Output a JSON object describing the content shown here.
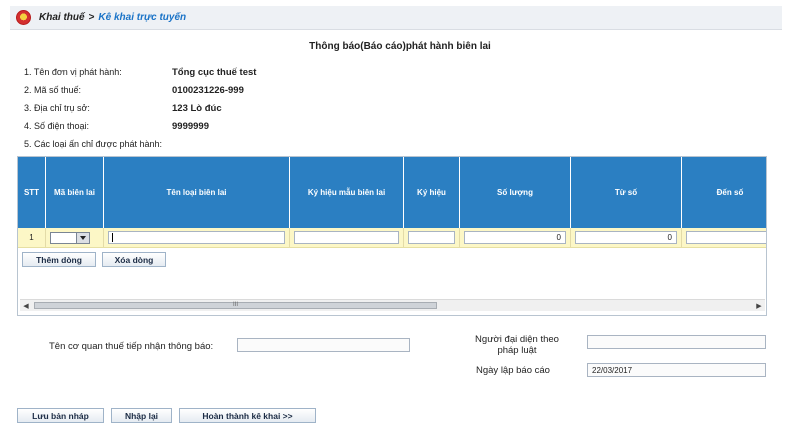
{
  "breadcrumb": {
    "parent": "Khai thuế",
    "separator": ">",
    "current": "Kê khai trực tuyến"
  },
  "form": {
    "title": "Thông báo(Báo cáo)phát hành biên lai",
    "info": [
      {
        "label": "1. Tên đơn vị phát hành:",
        "value": "Tổng cục thuế test"
      },
      {
        "label": "2. Mã số thuế:",
        "value": "0100231226-999"
      },
      {
        "label": "3. Địa chỉ trụ sở:",
        "value": "123 Lò đúc"
      },
      {
        "label": "4. Số điện thoại:",
        "value": "9999999"
      },
      {
        "label": "5. Các loại ấn chỉ được phát hành:",
        "value": ""
      }
    ]
  },
  "table": {
    "columns": [
      "STT",
      "Mã biên lai",
      "Tên loại biên lai",
      "Ký hiệu mẫu biên lai",
      "Ký hiệu",
      "Số lượng",
      "Từ số",
      "Đến số"
    ],
    "row": {
      "stt": "1",
      "ma_bien_lai": "",
      "ten_loai": "",
      "ky_hieu_mau": "",
      "ky_hieu": "",
      "so_luong": "0",
      "tu_so": "0",
      "den_so": ""
    },
    "add_row_label": "Thêm dòng",
    "delete_row_label": "Xóa dòng",
    "scroll_thumb_label": "III"
  },
  "receiver": {
    "label": "Tên cơ quan thuế tiếp nhận thông báo:",
    "value": ""
  },
  "representative": {
    "label_line1": "Người đại diện theo",
    "label_line2": "pháp luật",
    "value": ""
  },
  "report_date": {
    "label": "Ngày lập báo cáo",
    "value": "22/03/2017"
  },
  "actions": {
    "save_draft": "Lưu bản nháp",
    "reset": "Nhập lại",
    "complete": "Hoàn thành kê khai >>"
  },
  "colors": {
    "header_blue": "#2b7fc2",
    "row_yellow": "#fcf7c6",
    "link_blue": "#1a73c7"
  }
}
